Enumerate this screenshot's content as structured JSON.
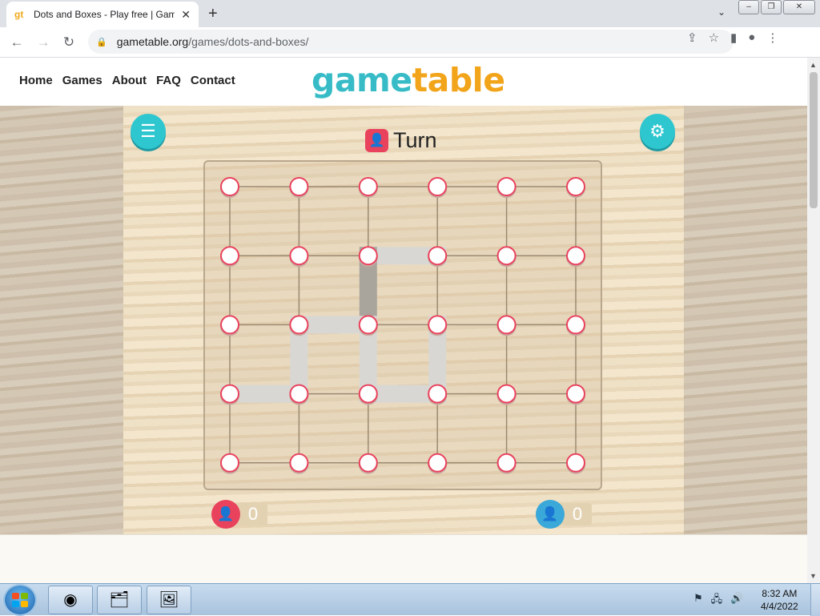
{
  "browser": {
    "tab_title": "Dots and Boxes - Play free | Gam",
    "favicon_text": "gt",
    "url_host": "gametable.org",
    "url_path": "/games/dots-and-boxes/"
  },
  "site": {
    "nav": [
      "Home",
      "Games",
      "About",
      "FAQ",
      "Contact"
    ],
    "logo_part1": "game",
    "logo_part2": "table",
    "logo_color1": "#37bcc7",
    "logo_color2": "#f2a41a"
  },
  "game": {
    "turn_label": "Turn",
    "current_player": "red",
    "grid": {
      "rows": 5,
      "cols": 6
    },
    "drawn_lines": [
      {
        "from": [
          1,
          2
        ],
        "to": [
          1,
          3
        ],
        "style": "light"
      },
      {
        "from": [
          1,
          2
        ],
        "to": [
          2,
          2
        ],
        "style": "dark"
      },
      {
        "from": [
          2,
          1
        ],
        "to": [
          2,
          2
        ],
        "style": "light"
      },
      {
        "from": [
          2,
          1
        ],
        "to": [
          3,
          1
        ],
        "style": "light"
      },
      {
        "from": [
          2,
          2
        ],
        "to": [
          3,
          2
        ],
        "style": "light"
      },
      {
        "from": [
          2,
          3
        ],
        "to": [
          3,
          3
        ],
        "style": "light"
      },
      {
        "from": [
          3,
          0
        ],
        "to": [
          3,
          1
        ],
        "style": "light"
      },
      {
        "from": [
          3,
          2
        ],
        "to": [
          3,
          3
        ],
        "style": "light"
      }
    ],
    "scores": {
      "red": "0",
      "blue": "0"
    },
    "colors": {
      "red": "#e9425d",
      "blue": "#3aa8d8",
      "teal": "#2ec6cf"
    }
  },
  "taskbar": {
    "time": "8:32 AM",
    "date": "4/4/2022"
  }
}
